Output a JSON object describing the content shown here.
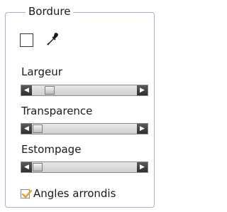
{
  "panel": {
    "title": "Bordure",
    "border_color": "#9fb3cf"
  },
  "color": {
    "swatch_value": "#ffffff",
    "picker_icon": "eyedropper-icon"
  },
  "sliders": [
    {
      "label": "Largeur",
      "value_fraction": 0.1
    },
    {
      "label": "Transparence",
      "value_fraction": 0.0
    },
    {
      "label": "Estompage",
      "value_fraction": 0.0
    }
  ],
  "rounded_corners": {
    "label": "Angles arrondis",
    "checked": true,
    "check_color": "#e8a020"
  }
}
